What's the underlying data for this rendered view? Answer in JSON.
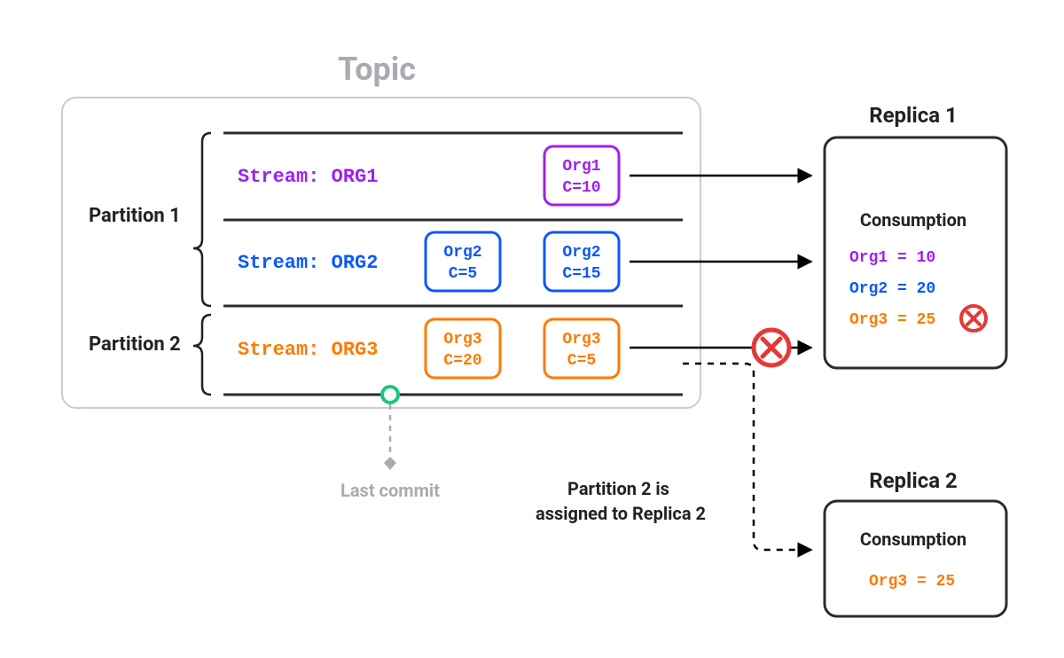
{
  "title": "Topic",
  "partitions": [
    {
      "label": "Partition 1",
      "streams": [
        {
          "name": "ORG1",
          "label": "Stream: ORG1",
          "color": "#a020f0",
          "events": [
            {
              "org": "Org1",
              "c": 10
            }
          ]
        },
        {
          "name": "ORG2",
          "label": "Stream: ORG2",
          "color": "#0a58ff",
          "events": [
            {
              "org": "Org2",
              "c": 5
            },
            {
              "org": "Org2",
              "c": 15
            }
          ]
        }
      ]
    },
    {
      "label": "Partition 2",
      "streams": [
        {
          "name": "ORG3",
          "label": "Stream: ORG3",
          "color": "#ff7a00",
          "events": [
            {
              "org": "Org3",
              "c": 20
            },
            {
              "org": "Org3",
              "c": 5
            }
          ]
        }
      ]
    }
  ],
  "lastCommit": {
    "label": "Last commit",
    "markerColor": "#18c97a"
  },
  "reassignNote": "Partition 2 is\nassigned to Replica 2",
  "replicas": [
    {
      "title": "Replica 1",
      "consumptionLabel": "Consumption",
      "rows": [
        {
          "org": "Org1",
          "value": 10,
          "color": "#a020f0",
          "error": false
        },
        {
          "org": "Org2",
          "value": 20,
          "color": "#0a58ff",
          "error": false
        },
        {
          "org": "Org3",
          "value": 25,
          "color": "#ff7a00",
          "error": true
        }
      ]
    },
    {
      "title": "Replica 2",
      "consumptionLabel": "Consumption",
      "rows": [
        {
          "org": "Org3",
          "value": 25,
          "color": "#ff7a00",
          "error": false
        }
      ]
    }
  ],
  "failureIconColor": "#e53935"
}
